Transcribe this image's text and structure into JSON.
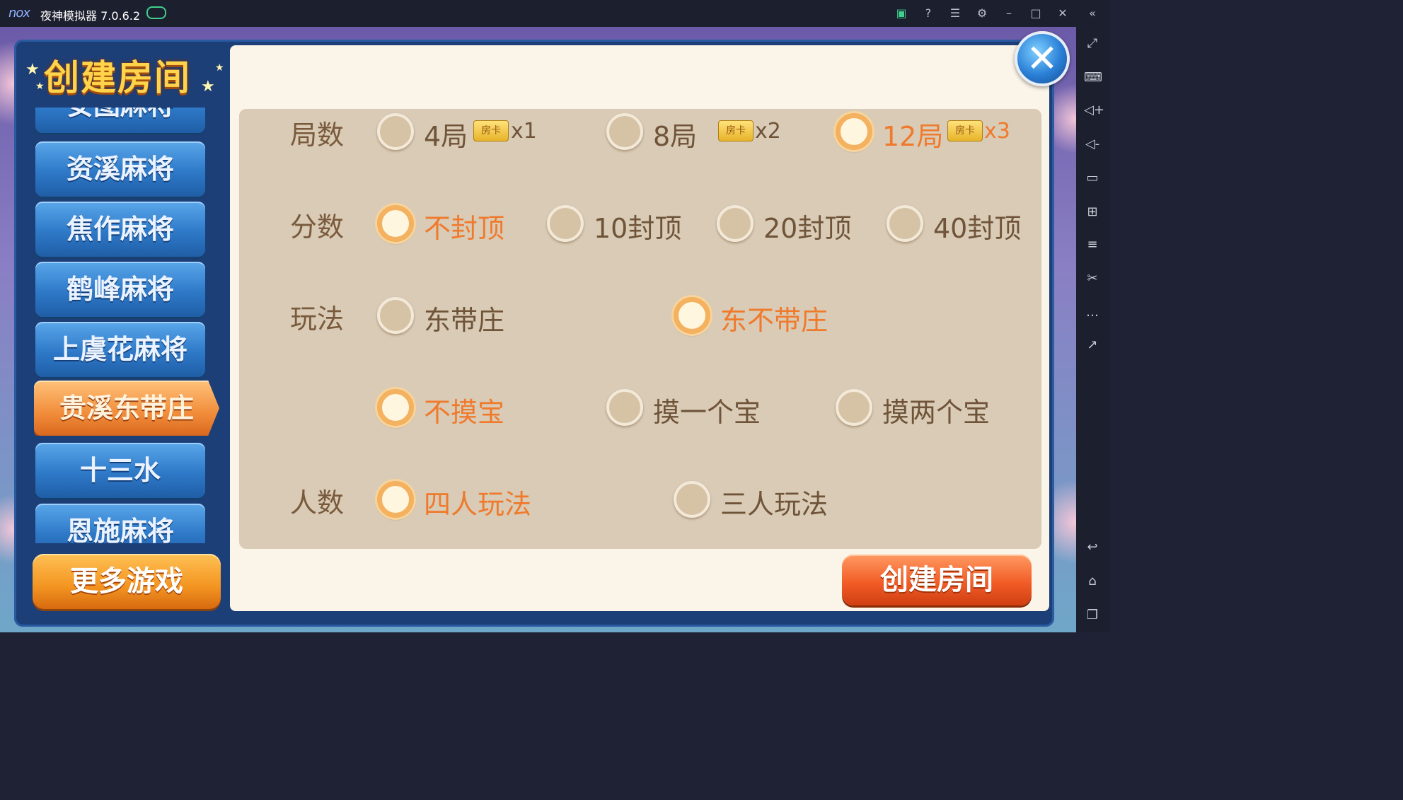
{
  "titlebar": {
    "logo": "nox",
    "title": "夜神模拟器 7.0.6.2",
    "icons": [
      "gamepad-icon",
      "phone-icon",
      "help-icon",
      "menu-icon",
      "settings-icon",
      "minimize-icon",
      "maximize-icon",
      "close-window-icon",
      "collapse-icon"
    ]
  },
  "sidebar": {
    "icons": [
      "fullscreen-icon",
      "keyboard-icon",
      "volume-up-icon",
      "volume-down-icon",
      "screen-icon",
      "apk-install-icon",
      "multi-instance-icon",
      "screenshot-icon",
      "more-icon",
      "share-icon",
      "back-icon",
      "home-icon",
      "recent-apps-icon"
    ]
  },
  "dialog": {
    "title": "创建房间",
    "game_list": [
      {
        "label": "安图麻将",
        "active": false
      },
      {
        "label": "资溪麻将",
        "active": false
      },
      {
        "label": "焦作麻将",
        "active": false
      },
      {
        "label": "鹤峰麻将",
        "active": false
      },
      {
        "label": "上虞花麻将",
        "active": false
      },
      {
        "label": "贵溪东带庄",
        "active": true
      },
      {
        "label": "十三水",
        "active": false
      },
      {
        "label": "恩施麻将",
        "active": false
      }
    ],
    "more_games_label": "更多游戏",
    "create_label": "创建房间",
    "card_label": "房卡",
    "rows": {
      "rounds": {
        "label": "局数",
        "options": [
          {
            "text": "4局",
            "mult": "x1",
            "selected": false
          },
          {
            "text": "8局",
            "mult": "x2",
            "selected": false
          },
          {
            "text": "12局",
            "mult": "x3",
            "selected": true
          }
        ]
      },
      "score": {
        "label": "分数",
        "options": [
          {
            "text": "不封顶",
            "selected": true
          },
          {
            "text": "10封顶",
            "selected": false
          },
          {
            "text": "20封顶",
            "selected": false
          },
          {
            "text": "40封顶",
            "selected": false
          }
        ]
      },
      "play": {
        "label": "玩法",
        "options": [
          {
            "text": "东带庄",
            "selected": false
          },
          {
            "text": "东不带庄",
            "selected": true
          }
        ]
      },
      "bao": {
        "label": "",
        "options": [
          {
            "text": "不摸宝",
            "selected": true
          },
          {
            "text": "摸一个宝",
            "selected": false
          },
          {
            "text": "摸两个宝",
            "selected": false
          }
        ]
      },
      "players": {
        "label": "人数",
        "options": [
          {
            "text": "四人玩法",
            "selected": true
          },
          {
            "text": "三人玩法",
            "selected": false
          }
        ]
      }
    }
  },
  "colors": {
    "selected_text": "#f07a2c",
    "normal_text": "#6f5439",
    "panel_bg": "#d9cbb6",
    "list_button": "#2e79c8",
    "active_button": "#f18c3a"
  }
}
